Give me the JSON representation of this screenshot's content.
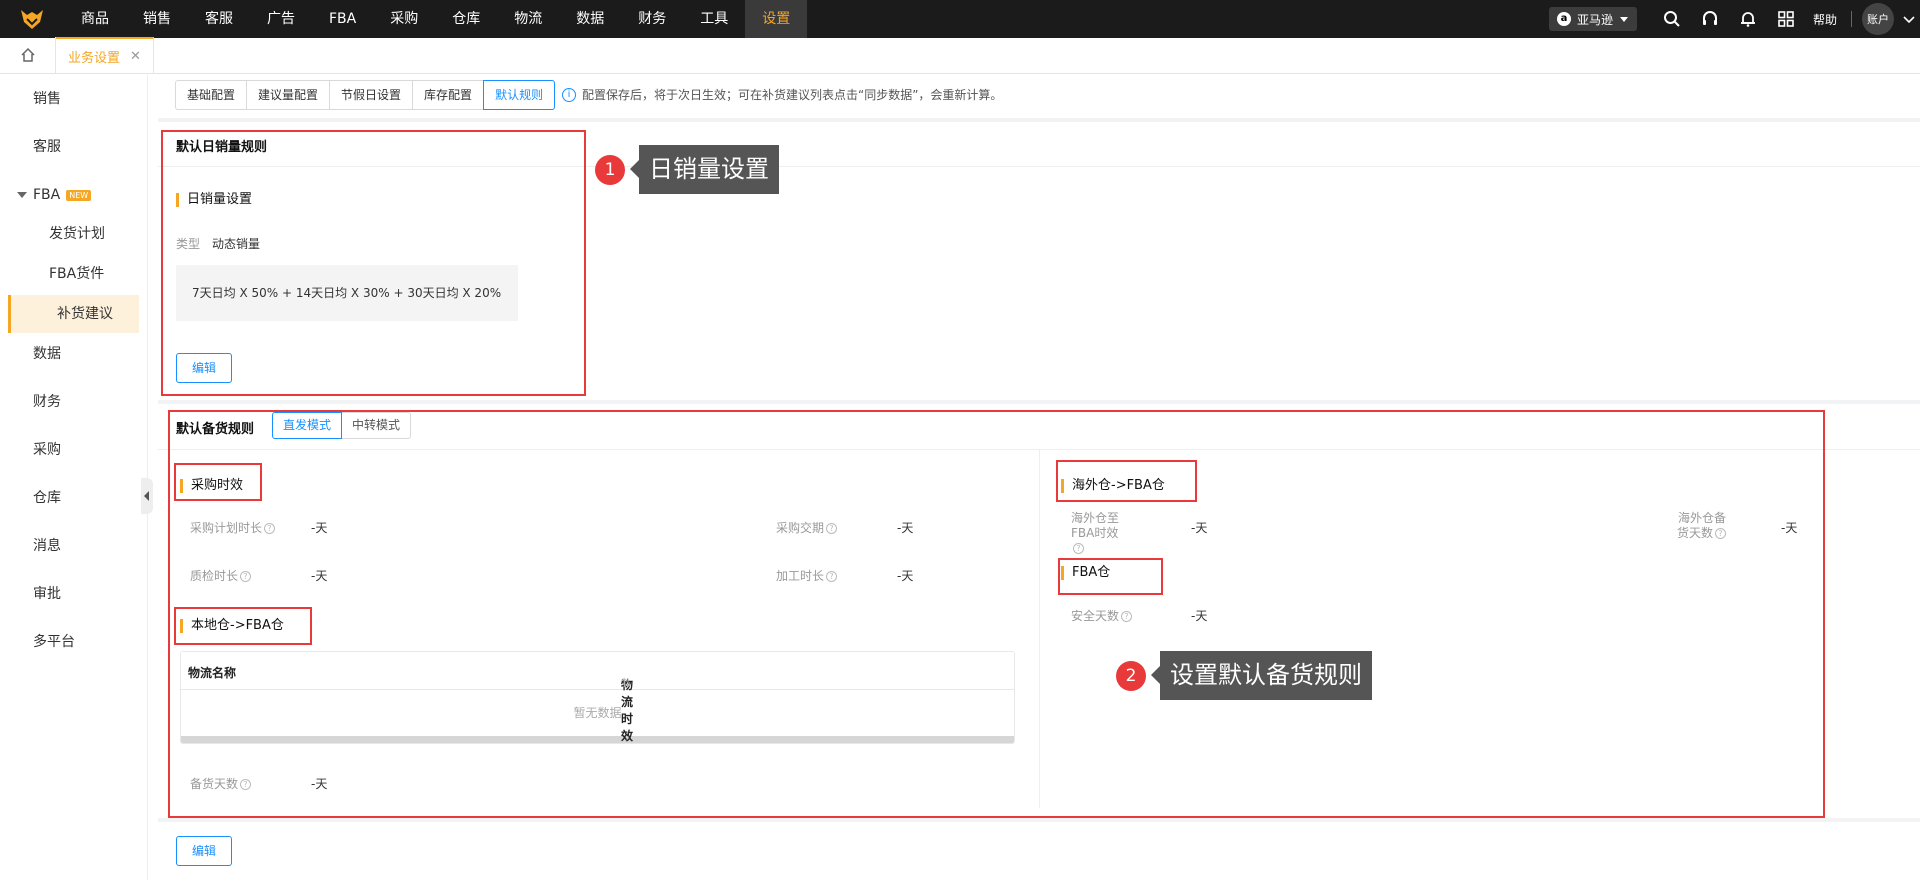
{
  "topnav": {
    "items": [
      "商品",
      "销售",
      "客服",
      "广告",
      "FBA",
      "采购",
      "仓库",
      "物流",
      "数据",
      "财务",
      "工具",
      "设置"
    ],
    "active_index": 11,
    "shop_label": "亚马逊",
    "shop_icon": "a",
    "help_label": "帮助",
    "account_label": "账户"
  },
  "tabbar": {
    "page_tab": "业务设置",
    "close": "✕"
  },
  "sidebar": {
    "sales": "销售",
    "service": "客服",
    "fba": "FBA",
    "new_badge": "NEW",
    "fba_children": [
      "发货计划",
      "FBA货件",
      "补货建议"
    ],
    "active": "补货建议",
    "data": "数据",
    "finance": "财务",
    "purchase": "采购",
    "warehouse": "仓库",
    "message": "消息",
    "approval": "审批",
    "multiplatform": "多平台"
  },
  "config_tabs": [
    "基础配置",
    "建议量配置",
    "节假日设置",
    "库存配置",
    "默认规则"
  ],
  "notice": "配置保存后，将于次日生效；可在补货建议列表点击“同步数据”，会重新计算。",
  "daily_sales": {
    "title": "默认日销量规则",
    "subtitle": "日销量设置",
    "type_label": "类型",
    "type_value": "动态销量",
    "formula": "7天日均 X 50% + 14天日均 X 30% + 30天日均 X 20%",
    "edit_button": "编辑"
  },
  "stock_rules": {
    "title": "默认备货规则",
    "modes": [
      "直发模式",
      "中转模式"
    ],
    "active_mode": "直发模式",
    "purchase_section": "采购时效",
    "purchase_plan_label": "采购计划时长",
    "purchase_plan_value": "-天",
    "delivery_label": "采购交期",
    "delivery_value": "-天",
    "qc_label": "质检时长",
    "qc_value": "-天",
    "processing_label": "加工时长",
    "processing_value": "-天",
    "local_section": "本地仓->FBA仓",
    "table_headers": [
      "物流名称",
      "物流时效"
    ],
    "sort_icon": "⇅",
    "empty_text": "暂无数据",
    "stock_days_label": "备货天数",
    "stock_days_value": "-天",
    "overseas_section": "海外仓->FBA仓",
    "overseas_to_fba_label_1": "海外仓至",
    "overseas_to_fba_label_2": "FBA时效",
    "overseas_to_fba_value": "-天",
    "overseas_stock_label_1": "海外仓备",
    "overseas_stock_label_2": "货天数",
    "overseas_stock_value": "-天",
    "fba_section": "FBA仓",
    "safety_days_label": "安全天数",
    "safety_days_value": "-天",
    "edit_button": "编辑"
  },
  "callouts": {
    "one_number": "1",
    "one_text": "日销量设置",
    "two_number": "2",
    "two_text": "设置默认备货规则"
  },
  "colors": {
    "accent": "#f5a623",
    "primary": "#1890ff",
    "annotation": "#e8393b",
    "topbar": "#1b1b1b"
  },
  "icons": [
    "fox-logo-icon",
    "amazon-icon",
    "chevron-down-icon",
    "search-icon",
    "headset-icon",
    "bell-icon",
    "apps-icon",
    "home-icon",
    "info-icon",
    "help-icon",
    "sort-icon",
    "collapse-icon"
  ]
}
